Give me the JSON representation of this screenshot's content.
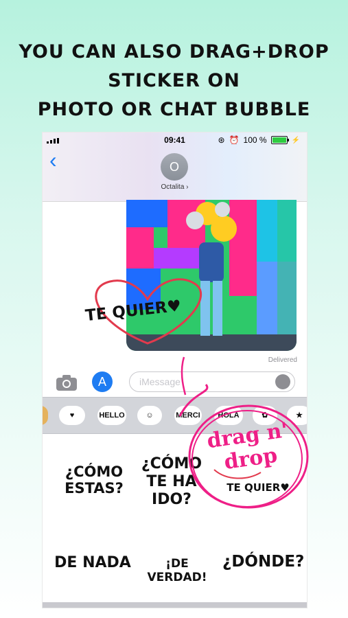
{
  "headline": {
    "line1": "YOU CAN ALSO DRAG+DROP STICKER ON",
    "line2": "PHOTO OR CHAT BUBBLE"
  },
  "status_bar": {
    "time": "09:41",
    "battery_percent": "100 %",
    "battery_level": 1.0
  },
  "header": {
    "avatar_initial": "O",
    "contact_name": "Octalita ›"
  },
  "chat": {
    "photo_sticker_text": "TE QUIER♥",
    "delivered_label": "Delivered"
  },
  "input": {
    "placeholder": "iMessage"
  },
  "sticker_strip": {
    "items": [
      "HELLO",
      "MERCI",
      "HOLA"
    ]
  },
  "sticker_grid": {
    "row1": [
      "¿CÓMO\nESTAS?",
      "¿CÓMO\nTE HA\nIDO?",
      "TE QUIER♥"
    ],
    "row2": [
      "DE NADA",
      "¡DE VERDAD!",
      "¿DÓNDE?"
    ]
  },
  "annotation": {
    "text_line1": "drag n'",
    "text_line2": "drop",
    "color": "#ee1f87"
  },
  "colors": {
    "accent_blue": "#1e7cf2",
    "background_top": "#b6f2de"
  }
}
